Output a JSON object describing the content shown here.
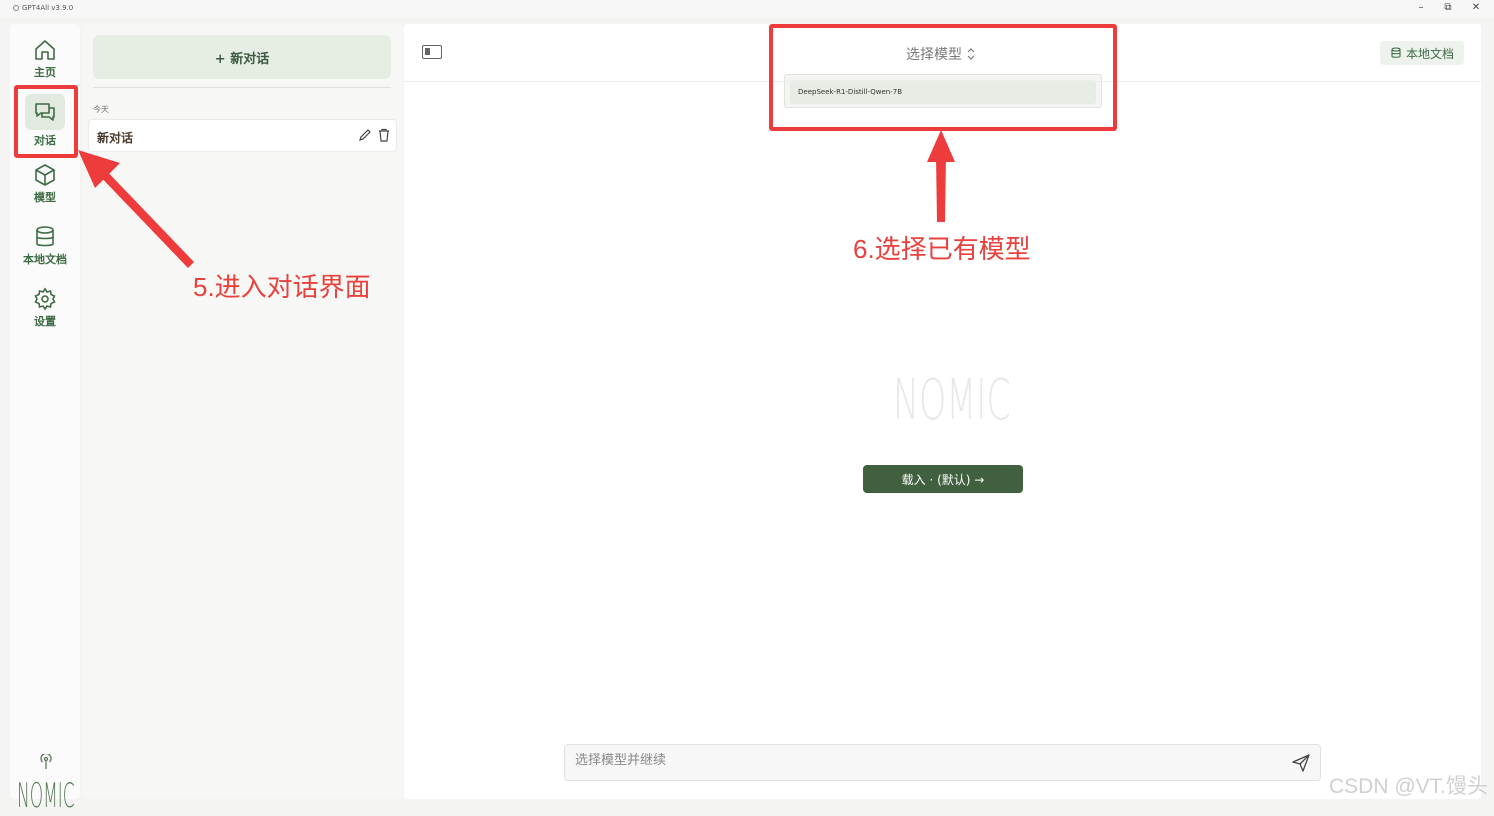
{
  "window": {
    "title": "GPT4All v3.9.0",
    "minimize": "–",
    "restore": "⧉",
    "close": "✕"
  },
  "rail": {
    "items": [
      {
        "label": "主页",
        "icon": "home-icon"
      },
      {
        "label": "对话",
        "icon": "chat-icon",
        "active": true
      },
      {
        "label": "模型",
        "icon": "cube-icon"
      },
      {
        "label": "本地文档",
        "icon": "database-icon"
      },
      {
        "label": "设置",
        "icon": "gear-icon"
      }
    ],
    "logo": "NOMIC"
  },
  "history": {
    "new_chat_label": "+ 新对话",
    "day_label": "今天",
    "chats": [
      {
        "title": "新对话"
      }
    ]
  },
  "main": {
    "model_select_label": "选择模型",
    "model_options": [
      "DeepSeek-R1-Distill-Qwen-7B"
    ],
    "local_docs_label": "本地文档",
    "center_logo": "NOMIC",
    "load_button_label": "载入 · (默认) →",
    "input_placeholder": "选择模型并继续"
  },
  "annotations": {
    "step5": "5.进入对话界面",
    "step6": "6.选择已有模型",
    "color": "#ee3b3b"
  },
  "watermark": "CSDN @VT.馒头",
  "colors": {
    "accent": "#41603f",
    "accent_light": "#e6ede3",
    "nav_text": "#3f6b45"
  }
}
